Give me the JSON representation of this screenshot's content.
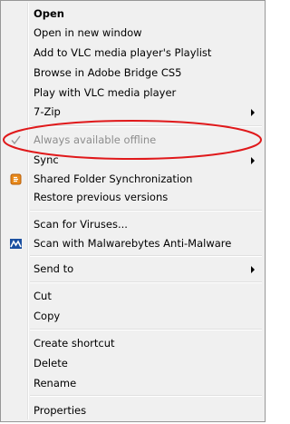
{
  "menu": {
    "open": "Open",
    "open_new_window": "Open in new window",
    "add_vlc_playlist": "Add to VLC media player's Playlist",
    "browse_bridge": "Browse in Adobe Bridge CS5",
    "play_vlc": "Play with VLC media player",
    "seven_zip": "7-Zip",
    "always_offline": "Always available offline",
    "sync": "Sync",
    "shared_folder_sync": "Shared Folder Synchronization",
    "restore_versions": "Restore previous versions",
    "scan_viruses": "Scan for Viruses...",
    "scan_malwarebytes": "Scan with Malwarebytes Anti-Malware",
    "send_to": "Send to",
    "cut": "Cut",
    "copy": "Copy",
    "create_shortcut": "Create shortcut",
    "delete": "Delete",
    "rename": "Rename",
    "properties": "Properties"
  },
  "icons": {
    "offline_check": "checkmark-icon",
    "shared_folder": "shared-folder-sync-icon",
    "malwarebytes": "malwarebytes-icon",
    "submenu": "chevron-right-icon"
  },
  "colors": {
    "annotation_red": "#e0191b",
    "disabled_text": "#8d8d8d",
    "menu_background": "#f0f0f0",
    "malwarebytes_blue": "#1a4fa0",
    "shared_folder_orange": "#e8891a"
  }
}
